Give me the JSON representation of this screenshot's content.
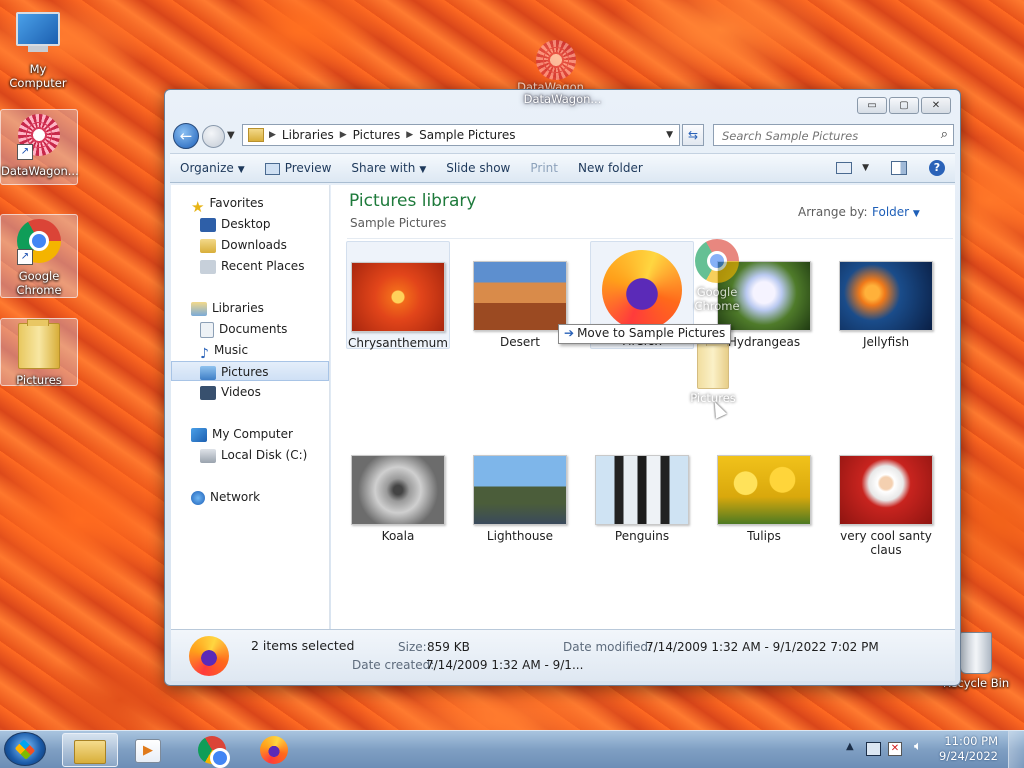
{
  "desktop": {
    "icons": [
      {
        "label": "My Computer"
      },
      {
        "label": "DataWagon..."
      },
      {
        "label": "Google Chrome"
      },
      {
        "label": "Pictures"
      },
      {
        "label": "Recycle Bin"
      }
    ],
    "drag_ghost_datawagon": "DataWagon...",
    "drag_ghost_chrome": "Google Chrome",
    "drag_ghost_pictures": "Pictures"
  },
  "window": {
    "title": "DataWagon...",
    "controls": {
      "minimize": "▭",
      "maximize": "▢",
      "close": "✕"
    },
    "address": {
      "segments": [
        "Libraries",
        "Pictures",
        "Sample Pictures"
      ]
    },
    "search": {
      "placeholder": "Search Sample Pictures"
    },
    "commands": [
      "Organize",
      "Preview",
      "Share with",
      "Slide show",
      "Print",
      "New folder"
    ],
    "help": "?"
  },
  "navpane": {
    "groups": [
      {
        "label": "Favorites",
        "items": [
          "Desktop",
          "Downloads",
          "Recent Places"
        ]
      },
      {
        "label": "Libraries",
        "items": [
          "Documents",
          "Music",
          "Pictures",
          "Videos"
        ]
      },
      {
        "label": "My Computer",
        "items": [
          "Local Disk (C:)"
        ]
      },
      {
        "label": "Network",
        "items": []
      }
    ],
    "selected": "Pictures"
  },
  "content": {
    "title": "Pictures library",
    "subtitle": "Sample Pictures",
    "arrange_label": "Arrange by:",
    "arrange_value": "Folder",
    "items": [
      {
        "name": "Chrysanthemum"
      },
      {
        "name": "Desert"
      },
      {
        "name": "Firefox"
      },
      {
        "name": "Hydrangeas"
      },
      {
        "name": "Jellyfish"
      },
      {
        "name": "Koala"
      },
      {
        "name": "Lighthouse"
      },
      {
        "name": "Penguins"
      },
      {
        "name": "Tulips"
      },
      {
        "name": "very cool santy claus"
      }
    ]
  },
  "tooltip": "Move to Sample Pictures",
  "details": {
    "selected": "2 items selected",
    "size_label": "Size:",
    "size_value": "859 KB",
    "modified_label": "Date modified:",
    "modified_value": "7/14/2009 1:32 AM - 9/1/2022 7:02 PM",
    "created_label": "Date created:",
    "created_value": "7/14/2009 1:32 AM - 9/1..."
  },
  "taskbar": {
    "clock_time": "11:00 PM",
    "clock_date": "9/24/2022"
  }
}
